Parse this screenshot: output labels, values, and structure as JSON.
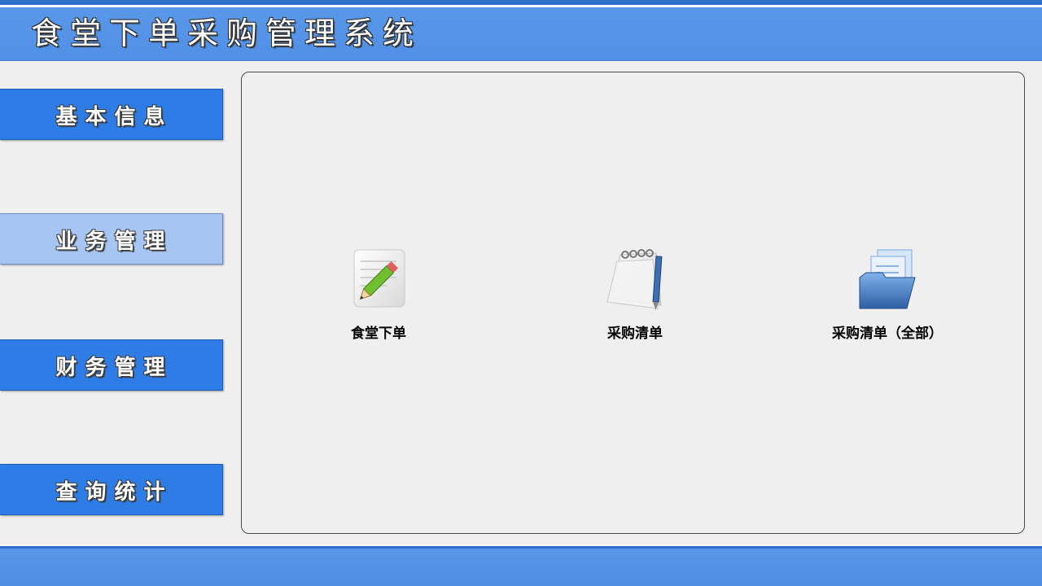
{
  "header": {
    "title": "食堂下单采购管理系统"
  },
  "sidebar": {
    "items": [
      {
        "label": "基本信息",
        "active": false
      },
      {
        "label": "业务管理",
        "active": true
      },
      {
        "label": "财务管理",
        "active": false
      },
      {
        "label": "查询统计",
        "active": false
      }
    ]
  },
  "main": {
    "tiles": [
      {
        "label": "食堂下单",
        "icon": "pencil-document-icon"
      },
      {
        "label": "采购清单",
        "icon": "notepad-pen-icon"
      },
      {
        "label": "采购清单（全部）",
        "icon": "folder-documents-icon"
      }
    ]
  },
  "colors": {
    "header_blue": "#5090e6",
    "button_blue": "#2e7de6",
    "button_active": "#a6c5f2",
    "background": "#f0eff0"
  }
}
